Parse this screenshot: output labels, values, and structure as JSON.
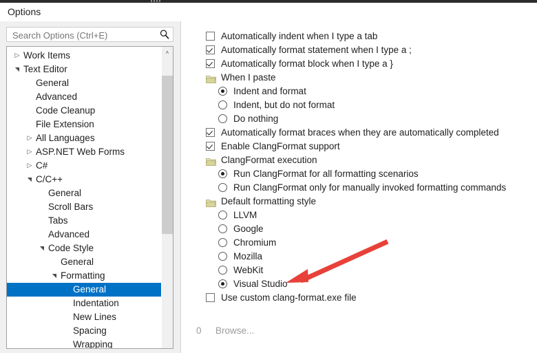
{
  "window": {
    "title": "Options"
  },
  "search": {
    "placeholder": "Search Options (Ctrl+E)",
    "value": "",
    "icon": "search-icon"
  },
  "tree": {
    "scrollbar": {
      "up_arrow": "˄"
    },
    "items": [
      {
        "label": "Work Items",
        "indent": 0,
        "expander": "collapsed",
        "selected": false
      },
      {
        "label": "Text Editor",
        "indent": 0,
        "expander": "expanded",
        "selected": false
      },
      {
        "label": "General",
        "indent": 1,
        "expander": "none",
        "selected": false
      },
      {
        "label": "Advanced",
        "indent": 1,
        "expander": "none",
        "selected": false
      },
      {
        "label": "Code Cleanup",
        "indent": 1,
        "expander": "none",
        "selected": false
      },
      {
        "label": "File Extension",
        "indent": 1,
        "expander": "none",
        "selected": false
      },
      {
        "label": "All Languages",
        "indent": 1,
        "expander": "collapsed",
        "selected": false
      },
      {
        "label": "ASP.NET Web Forms",
        "indent": 1,
        "expander": "collapsed",
        "selected": false
      },
      {
        "label": "C#",
        "indent": 1,
        "expander": "collapsed",
        "selected": false
      },
      {
        "label": "C/C++",
        "indent": 1,
        "expander": "expanded",
        "selected": false
      },
      {
        "label": "General",
        "indent": 2,
        "expander": "none",
        "selected": false
      },
      {
        "label": "Scroll Bars",
        "indent": 2,
        "expander": "none",
        "selected": false
      },
      {
        "label": "Tabs",
        "indent": 2,
        "expander": "none",
        "selected": false
      },
      {
        "label": "Advanced",
        "indent": 2,
        "expander": "none",
        "selected": false
      },
      {
        "label": "Code Style",
        "indent": 2,
        "expander": "expanded",
        "selected": false
      },
      {
        "label": "General",
        "indent": 3,
        "expander": "none",
        "selected": false
      },
      {
        "label": "Formatting",
        "indent": 3,
        "expander": "expanded",
        "selected": false
      },
      {
        "label": "General",
        "indent": 4,
        "expander": "none",
        "selected": true
      },
      {
        "label": "Indentation",
        "indent": 4,
        "expander": "none",
        "selected": false
      },
      {
        "label": "New Lines",
        "indent": 4,
        "expander": "none",
        "selected": false
      },
      {
        "label": "Spacing",
        "indent": 4,
        "expander": "none",
        "selected": false
      },
      {
        "label": "Wrapping",
        "indent": 4,
        "expander": "none",
        "selected": false
      }
    ]
  },
  "options": [
    {
      "kind": "checkbox",
      "label": "Automatically indent when I type a tab",
      "checked": false,
      "indent": 0
    },
    {
      "kind": "checkbox",
      "label": "Automatically format statement when I type a ;",
      "checked": true,
      "indent": 0
    },
    {
      "kind": "checkbox",
      "label": "Automatically format block when I type a }",
      "checked": true,
      "indent": 0
    },
    {
      "kind": "group",
      "label": "When I paste",
      "indent": 0
    },
    {
      "kind": "radio",
      "label": "Indent and format",
      "checked": true,
      "indent": 1
    },
    {
      "kind": "radio",
      "label": "Indent, but do not format",
      "checked": false,
      "indent": 1
    },
    {
      "kind": "radio",
      "label": "Do nothing",
      "checked": false,
      "indent": 1
    },
    {
      "kind": "checkbox",
      "label": "Automatically format braces when they are automatically completed",
      "checked": true,
      "indent": 0
    },
    {
      "kind": "checkbox",
      "label": "Enable ClangFormat support",
      "checked": true,
      "indent": 0
    },
    {
      "kind": "group",
      "label": "ClangFormat execution",
      "indent": 0
    },
    {
      "kind": "radio",
      "label": "Run ClangFormat for all formatting scenarios",
      "checked": true,
      "indent": 1
    },
    {
      "kind": "radio",
      "label": "Run ClangFormat only for manually invoked formatting commands",
      "checked": false,
      "indent": 1
    },
    {
      "kind": "group",
      "label": "Default formatting style",
      "indent": 0
    },
    {
      "kind": "radio",
      "label": "LLVM",
      "checked": false,
      "indent": 1
    },
    {
      "kind": "radio",
      "label": "Google",
      "checked": false,
      "indent": 1
    },
    {
      "kind": "radio",
      "label": "Chromium",
      "checked": false,
      "indent": 1
    },
    {
      "kind": "radio",
      "label": "Mozilla",
      "checked": false,
      "indent": 1
    },
    {
      "kind": "radio",
      "label": "WebKit",
      "checked": false,
      "indent": 1
    },
    {
      "kind": "radio",
      "label": "Visual Studio",
      "checked": true,
      "indent": 1
    },
    {
      "kind": "checkbox",
      "label": "Use custom clang-format.exe file",
      "checked": false,
      "indent": 0
    }
  ],
  "custom_path": {
    "value": "0",
    "browse_label": "Browse..."
  },
  "annotation": {
    "type": "arrow",
    "color": "#e8413a",
    "points_at": "Visual Studio"
  },
  "colors": {
    "selection_blue": "#0072c6",
    "dialog_background": "#f0f0f0",
    "panel_background": "#ffffff",
    "folder_icon": "#d8d59b",
    "annotation_red": "#e8413a"
  }
}
